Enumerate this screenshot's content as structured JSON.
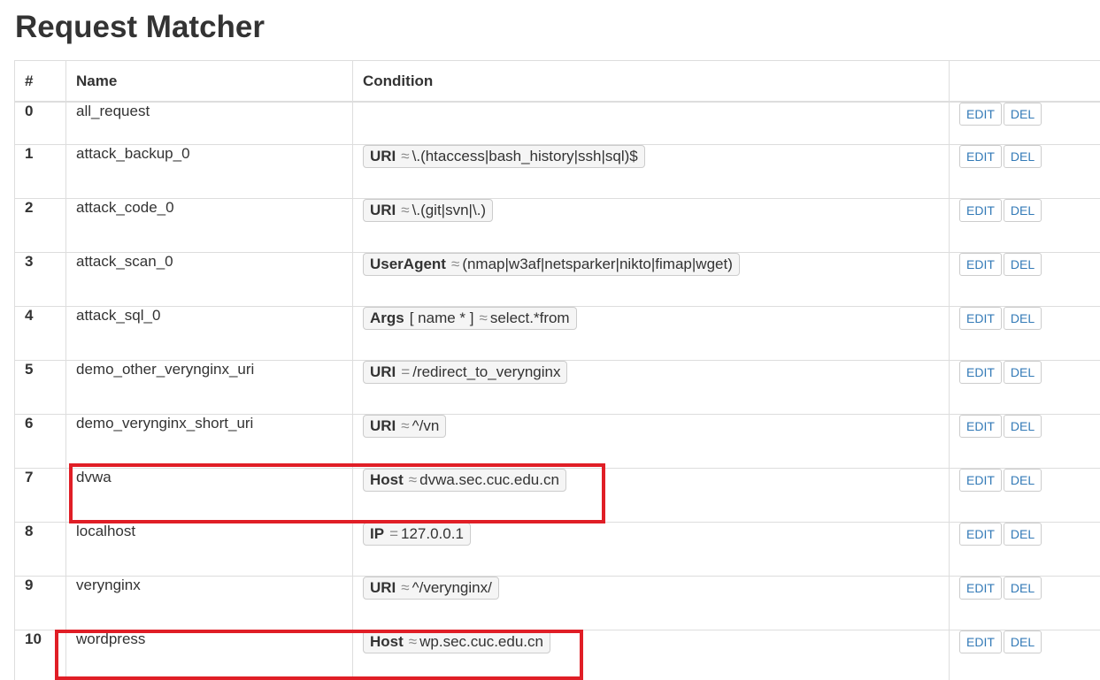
{
  "page": {
    "title": "Request Matcher"
  },
  "table": {
    "headers": [
      "#",
      "Name",
      "Condition",
      ""
    ],
    "rows": [
      {
        "idx": "0",
        "name": "all_request",
        "conditions": []
      },
      {
        "idx": "1",
        "name": "attack_backup_0",
        "conditions": [
          {
            "var": "URI",
            "key": "",
            "op": "≈",
            "value": "\\.(htaccess|bash_history|ssh|sql)$"
          }
        ]
      },
      {
        "idx": "2",
        "name": "attack_code_0",
        "conditions": [
          {
            "var": "URI",
            "key": "",
            "op": "≈",
            "value": "\\.(git|svn|\\.)"
          }
        ]
      },
      {
        "idx": "3",
        "name": "attack_scan_0",
        "conditions": [
          {
            "var": "UserAgent",
            "key": "",
            "op": "≈",
            "value": "(nmap|w3af|netsparker|nikto|fimap|wget)"
          }
        ]
      },
      {
        "idx": "4",
        "name": "attack_sql_0",
        "conditions": [
          {
            "var": "Args",
            "key": "[ name * ]",
            "op": "≈",
            "value": "select.*from"
          }
        ]
      },
      {
        "idx": "5",
        "name": "demo_other_verynginx_uri",
        "conditions": [
          {
            "var": "URI",
            "key": "",
            "op": "=",
            "value": "/redirect_to_verynginx"
          }
        ]
      },
      {
        "idx": "6",
        "name": "demo_verynginx_short_uri",
        "conditions": [
          {
            "var": "URI",
            "key": "",
            "op": "≈",
            "value": "^/vn"
          }
        ]
      },
      {
        "idx": "7",
        "name": "dvwa",
        "conditions": [
          {
            "var": "Host",
            "key": "",
            "op": "≈",
            "value": "dvwa.sec.cuc.edu.cn"
          }
        ]
      },
      {
        "idx": "8",
        "name": "localhost",
        "conditions": [
          {
            "var": "IP",
            "key": "",
            "op": "=",
            "value": "127.0.0.1"
          }
        ]
      },
      {
        "idx": "9",
        "name": "verynginx",
        "conditions": [
          {
            "var": "URI",
            "key": "",
            "op": "≈",
            "value": "^/verynginx/"
          }
        ]
      },
      {
        "idx": "10",
        "name": "wordpress",
        "conditions": [
          {
            "var": "Host",
            "key": "",
            "op": "≈",
            "value": "wp.sec.cuc.edu.cn"
          }
        ]
      }
    ]
  },
  "actions": {
    "edit_label": "EDIT",
    "del_label": "DEL"
  },
  "colors": {
    "highlight": "#e01e26",
    "link": "#337ab7",
    "border": "#dddddd"
  }
}
